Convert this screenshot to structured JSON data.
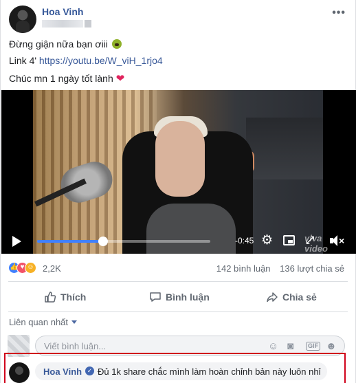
{
  "post": {
    "author": "Hoa Vinh",
    "more_icon": "more-horizontal-icon",
    "line1": "Đừng giận nữa bạn ơiii",
    "line2_prefix": "Link 4'",
    "line2_link": "https://youtu.be/W_viH_1rjo4",
    "line3": "Chúc mn 1 ngày tốt lành"
  },
  "video": {
    "time_remaining": "-0:45",
    "progress": 0.38,
    "watermark": "viva video"
  },
  "reactions": {
    "count": "2,2K",
    "comments": "142 bình luận",
    "shares": "136 lượt chia sẻ",
    "like_color": "#4080ff",
    "love_color": "#f25268",
    "haha_color": "#f7b125"
  },
  "actions": {
    "like": "Thích",
    "comment": "Bình luận",
    "share": "Chia sẻ"
  },
  "comments": {
    "sort": "Liên quan nhất",
    "placeholder": "Viết bình luận...",
    "gif_label": "GIF",
    "reply_author": "Hoa Vinh",
    "reply_text": "Đủ 1k share chắc mình làm hoàn chỉnh bản này luôn nhỉ"
  },
  "colors": {
    "link": "#385898",
    "highlight": "#d0021b"
  }
}
